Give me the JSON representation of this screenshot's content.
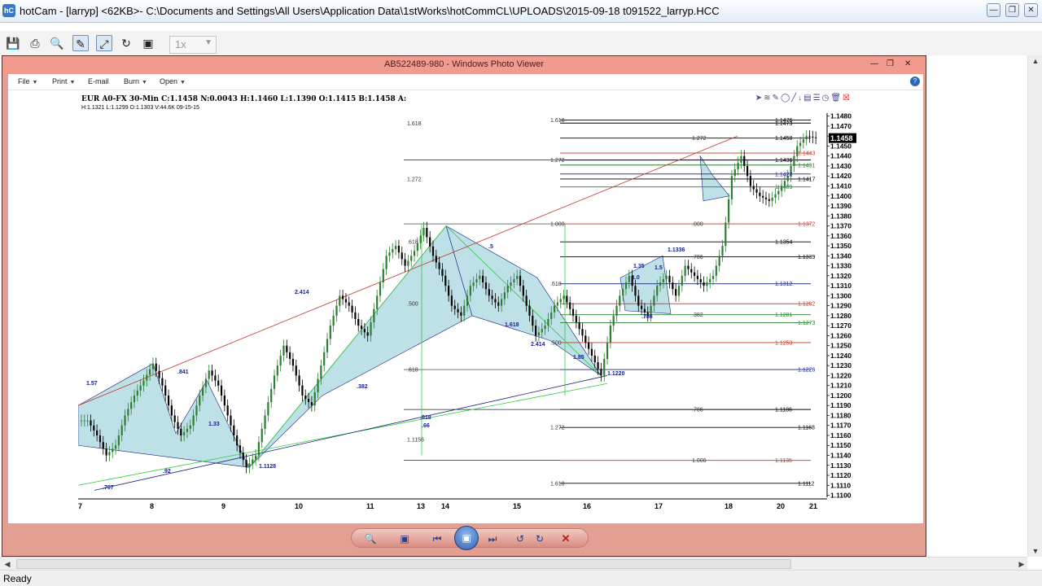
{
  "app": {
    "title": "hotCam - [larryp] <62KB>- C:\\Documents and Settings\\All Users\\Application Data\\1stWorks\\hotCommCL\\UPLOADS\\2015-09-18 t091522_larryp.HCC",
    "icon_label": "hC",
    "window_controls": [
      "minimize-icon",
      "restore-icon",
      "close-icon"
    ]
  },
  "toolbar": {
    "icons": [
      "save-icon",
      "print-icon",
      "zoom-icon",
      "draw-icon",
      "fit-icon",
      "refresh-icon",
      "export-icon"
    ],
    "zoom_value": "1x"
  },
  "photo_viewer": {
    "title": "AB522489-980 - Windows Photo Viewer",
    "menu": [
      "File",
      "Print",
      "E-mail",
      "Burn",
      "Open"
    ],
    "help_label": "?"
  },
  "chart_header": {
    "line1": "EUR A0-FX 30-Min C:1.1458 N:0.0043 H:1.1460 L:1.1390 O:1.1415 B:1.1458 A:",
    "line2": "H:1.1321 L:1.1299 O:1.1303 V:44.6K 09-15-15"
  },
  "chart_data": {
    "type": "line",
    "x_tick_labels": [
      "7",
      "8",
      "9",
      "10",
      "11",
      "13",
      "14",
      "15",
      "16",
      "17",
      "18",
      "20",
      "21"
    ],
    "y_tick_labels": [
      "1.1480",
      "1.1470",
      "1.1460",
      "1.1450",
      "1.1440",
      "1.1430",
      "1.1420",
      "1.1410",
      "1.1400",
      "1.1390",
      "1.1380",
      "1.1370",
      "1.1360",
      "1.1350",
      "1.1340",
      "1.1330",
      "1.1320",
      "1.1310",
      "1.1300",
      "1.1290",
      "1.1280",
      "1.1270",
      "1.1260",
      "1.1250",
      "1.1240",
      "1.1230",
      "1.1220",
      "1.1210",
      "1.1200",
      "1.1190",
      "1.1180",
      "1.1170",
      "1.1160",
      "1.1150",
      "1.1140",
      "1.1130",
      "1.1120",
      "1.1110",
      "1.1100"
    ],
    "ylim": [
      1.1098,
      1.1483
    ],
    "current_price": "1.1458",
    "price_labels": [
      {
        "text": "1.1476",
        "value": 1.1476,
        "color": "#000000"
      },
      {
        "text": "1.1473",
        "value": 1.1473,
        "color": "#000000"
      },
      {
        "text": "1.1458",
        "value": 1.1458,
        "color": "#000000"
      },
      {
        "text": "1.1443",
        "value": 1.1443,
        "color": "#c0392b"
      },
      {
        "text": "1.1436",
        "value": 1.1436,
        "color": "#000000"
      },
      {
        "text": "1.1431",
        "value": 1.1431,
        "color": "#2e7d32"
      },
      {
        "text": "1.1422",
        "value": 1.1422,
        "color": "#1a237e"
      },
      {
        "text": "1.1417",
        "value": 1.1417,
        "color": "#000000"
      },
      {
        "text": "1.1409",
        "value": 1.1409,
        "color": "#2e7d32"
      },
      {
        "text": "1.1372",
        "value": 1.1372,
        "color": "#c0392b"
      },
      {
        "text": "1.1354",
        "value": 1.1354,
        "color": "#000000"
      },
      {
        "text": "1.1339",
        "value": 1.1339,
        "color": "#000000"
      },
      {
        "text": "1.1312",
        "value": 1.1312,
        "color": "#1a237e"
      },
      {
        "text": "1.1292",
        "value": 1.1292,
        "color": "#c0392b"
      },
      {
        "text": "1.1281",
        "value": 1.1281,
        "color": "#2e7d32"
      },
      {
        "text": "1.1273",
        "value": 1.1273,
        "color": "#2e7d32"
      },
      {
        "text": "1.1253",
        "value": 1.1253,
        "color": "#c0392b"
      },
      {
        "text": "1.1226",
        "value": 1.1226,
        "color": "#1a237e"
      },
      {
        "text": "1.1186",
        "value": 1.1186,
        "color": "#000000"
      },
      {
        "text": "1.1168",
        "value": 1.1168,
        "color": "#000000"
      },
      {
        "text": "1.1135",
        "value": 1.1135,
        "color": "#c0392b"
      },
      {
        "text": "1.1112",
        "value": 1.1112,
        "color": "#000000"
      }
    ],
    "fib_labels": [
      {
        "text": "1.618",
        "value": 1.1476
      },
      {
        "text": "1.618",
        "value": 1.1473
      },
      {
        "text": "1.272",
        "value": 1.1458
      },
      {
        "text": "1.272",
        "value": 1.1436
      },
      {
        "text": "1.272",
        "value": 1.1417
      },
      {
        "text": ".000",
        "value": 1.1372
      },
      {
        "text": "1.000",
        "value": 1.1372
      },
      {
        "text": ".618",
        "value": 1.1354
      },
      {
        "text": ".786",
        "value": 1.1339
      },
      {
        "text": ".618",
        "value": 1.1312
      },
      {
        "text": ".500",
        "value": 1.1292
      },
      {
        "text": ".382",
        "value": 1.1281
      },
      {
        "text": ".500",
        "value": 1.1253
      },
      {
        "text": ".618",
        "value": 1.1226
      },
      {
        "text": ".786",
        "value": 1.1186
      },
      {
        "text": "1.272",
        "value": 1.1168
      },
      {
        "text": "1.1156",
        "value": 1.1156
      },
      {
        "text": "1.000",
        "value": 1.1135
      },
      {
        "text": "1.618",
        "value": 1.1112
      }
    ],
    "pattern_labels": [
      "2.414",
      "1.57",
      ".841",
      "1.33",
      ".92",
      ".707",
      ".382",
      ".618",
      ".66",
      "1.618",
      "2.414",
      "1.85",
      "1.1220",
      "1.1128",
      "1.35",
      "1.0",
      "1.5",
      ".786",
      "1.1336",
      ".5"
    ],
    "close_series": [
      1.1175,
      1.116,
      1.114,
      1.115,
      1.118,
      1.12,
      1.1215,
      1.1232,
      1.121,
      1.118,
      1.116,
      1.117,
      1.12,
      1.1225,
      1.121,
      1.118,
      1.115,
      1.1128,
      1.114,
      1.118,
      1.122,
      1.125,
      1.123,
      1.12,
      1.119,
      1.123,
      1.127,
      1.13,
      1.129,
      1.127,
      1.126,
      1.13,
      1.134,
      1.135,
      1.133,
      1.1345,
      1.1368,
      1.134,
      1.132,
      1.129,
      1.128,
      1.131,
      1.132,
      1.13,
      1.129,
      1.131,
      1.132,
      1.129,
      1.126,
      1.127,
      1.129,
      1.13,
      1.128,
      1.126,
      1.124,
      1.122,
      1.127,
      1.13,
      1.132,
      1.129,
      1.128,
      1.131,
      1.132,
      1.13,
      1.133,
      1.132,
      1.131,
      1.132,
      1.135,
      1.142,
      1.144,
      1.141,
      1.14,
      1.1395,
      1.1405,
      1.142,
      1.145,
      1.146,
      1.1458
    ],
    "current_price_color": "#000000",
    "candle_up_color": "#2e7d32",
    "candle_down_color": "#000000",
    "pattern_fill_color": "#a8d7df",
    "trendline_color": "#c0392b",
    "green_line_color": "#2ecc40",
    "navy_line_color": "#1a237e"
  },
  "viewer_controls": {
    "icons": [
      "zoom-icon",
      "actual-size-icon",
      "previous-icon",
      "slideshow-icon",
      "next-icon",
      "rotate-left-icon",
      "rotate-right-icon",
      "delete-icon"
    ]
  },
  "status": {
    "text": "Ready"
  }
}
